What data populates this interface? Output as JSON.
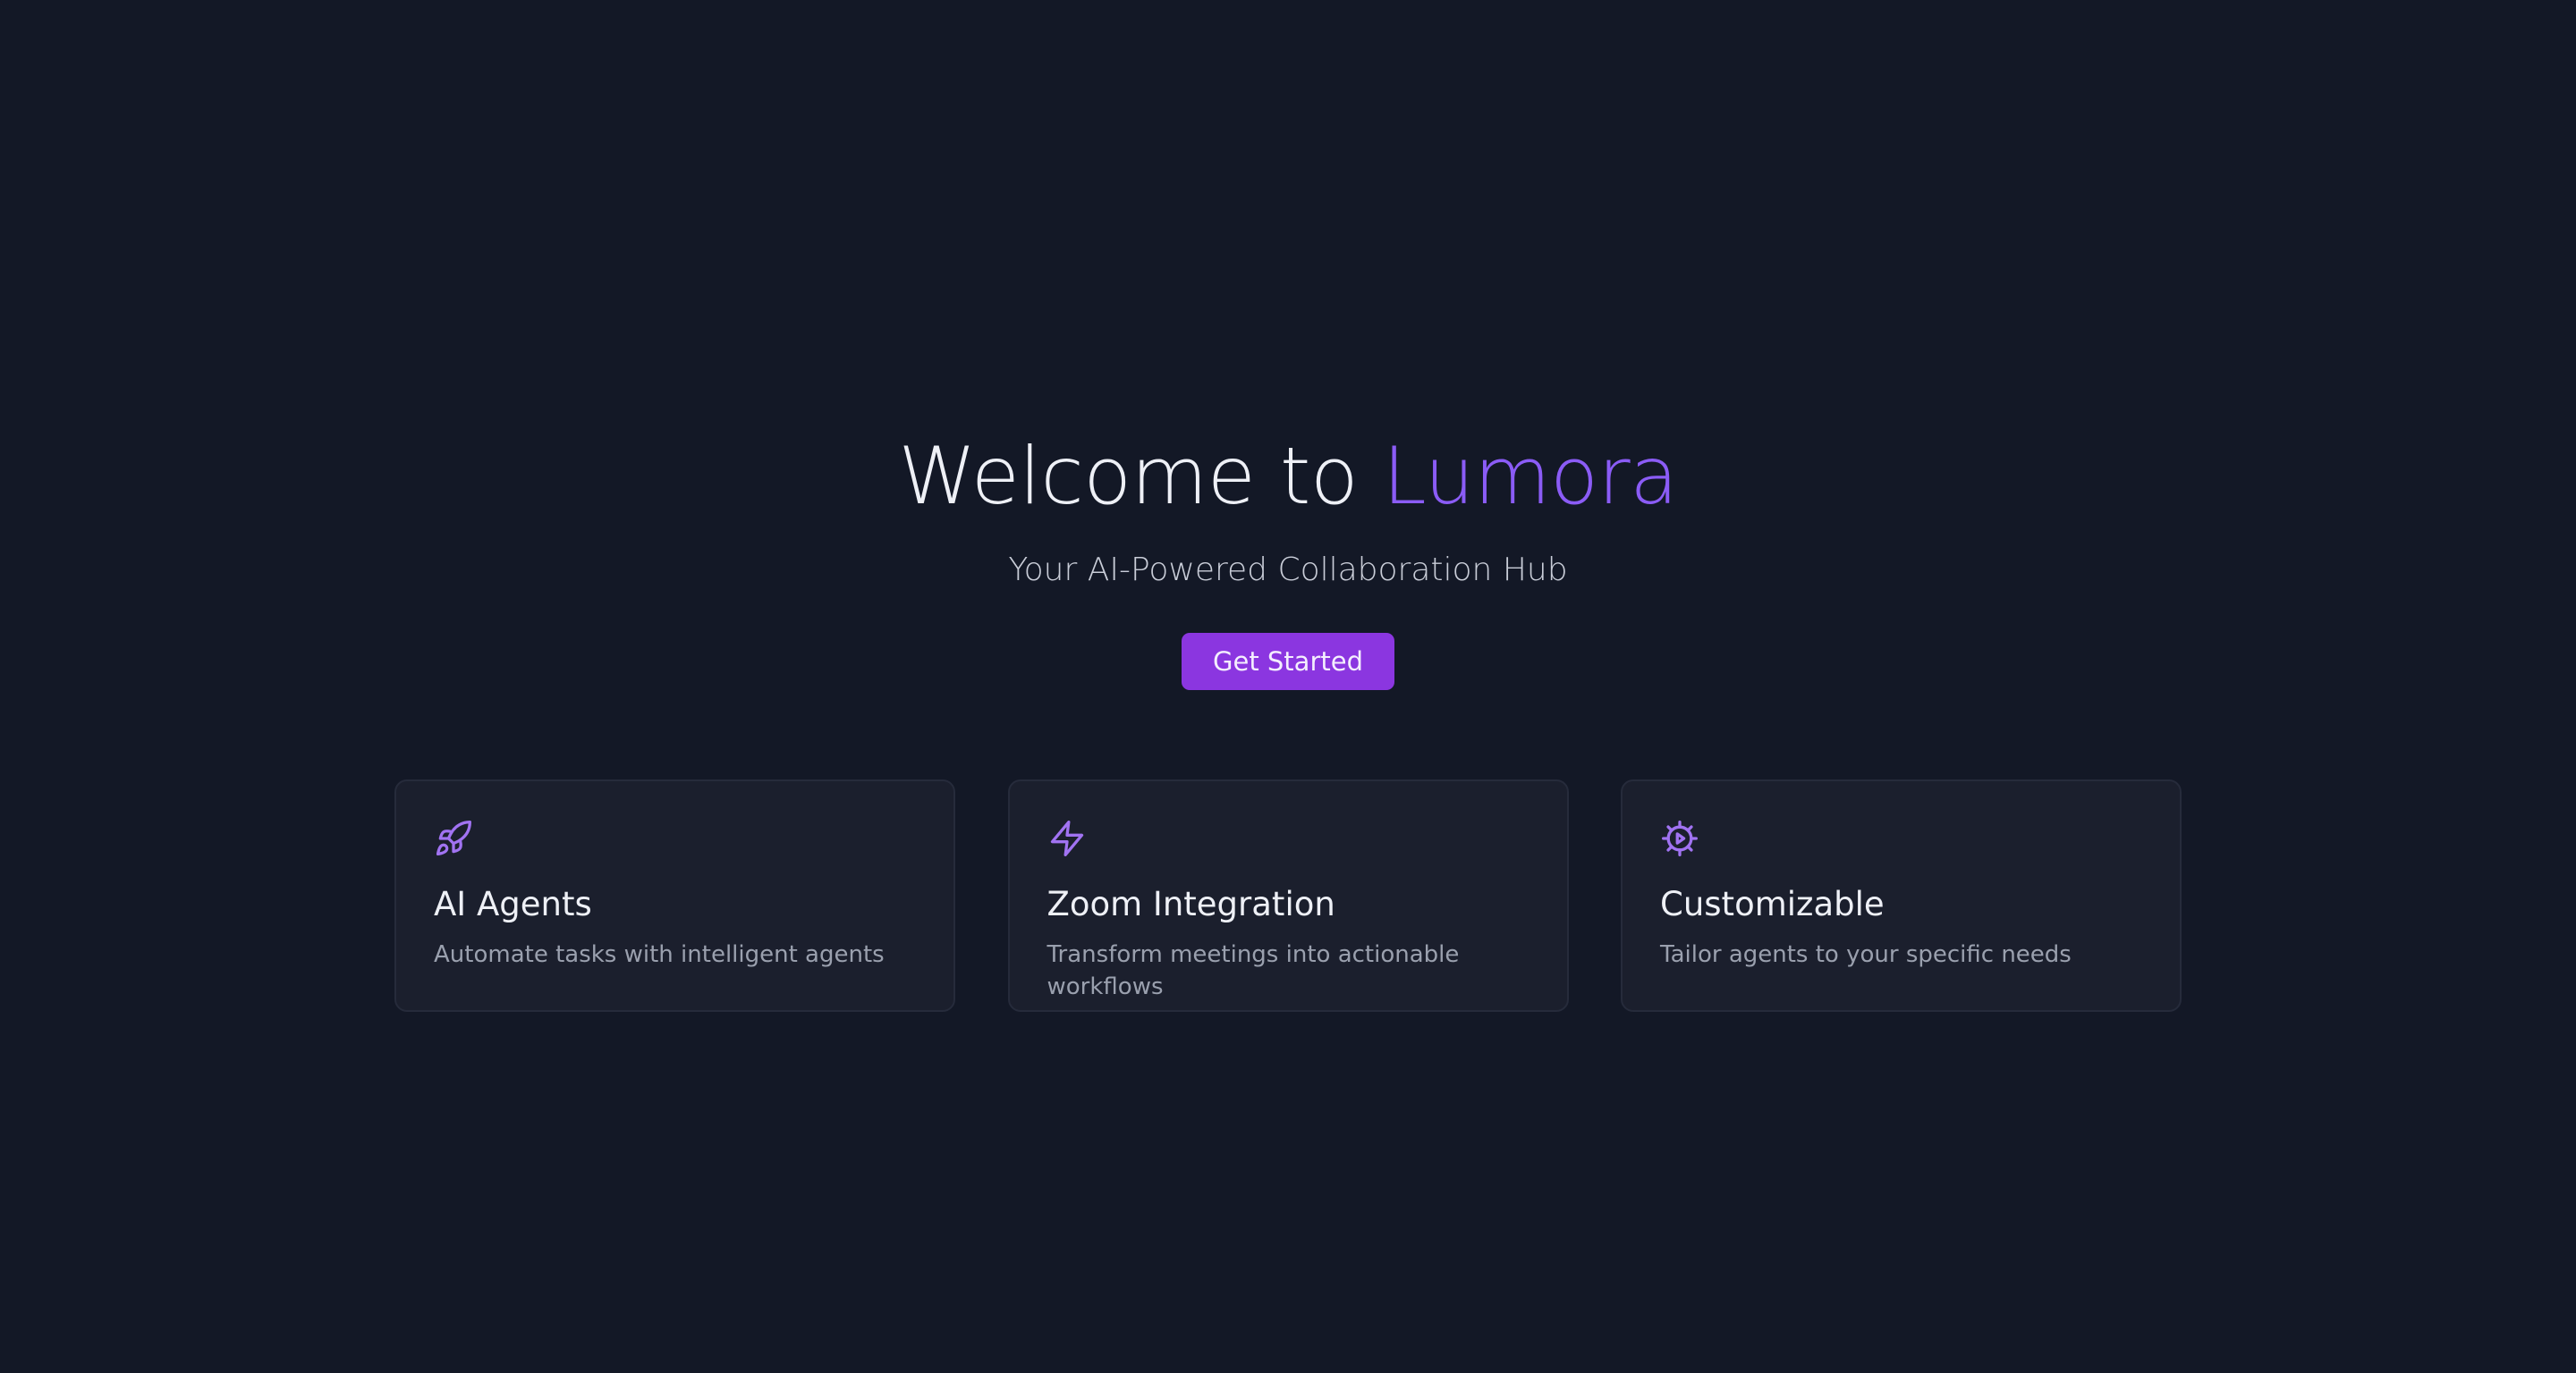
{
  "hero": {
    "title_prefix": "Welcome to ",
    "title_brand": "Lumora",
    "subtitle": "Your AI-Powered Collaboration Hub",
    "cta_label": "Get Started"
  },
  "features": [
    {
      "icon": "rocket-icon",
      "title": "AI Agents",
      "description": "Automate tasks with intelligent agents"
    },
    {
      "icon": "lightning-icon",
      "title": "Zoom Integration",
      "description": "Transform meetings into actionable workflows"
    },
    {
      "icon": "gear-icon",
      "title": "Customizable",
      "description": "Tailor agents to your specific needs"
    }
  ],
  "colors": {
    "background": "#131826",
    "accent": "#8b5cf6",
    "button": "#8b36e0",
    "card_background": "#1b1f2d",
    "card_border": "#262b3b"
  }
}
